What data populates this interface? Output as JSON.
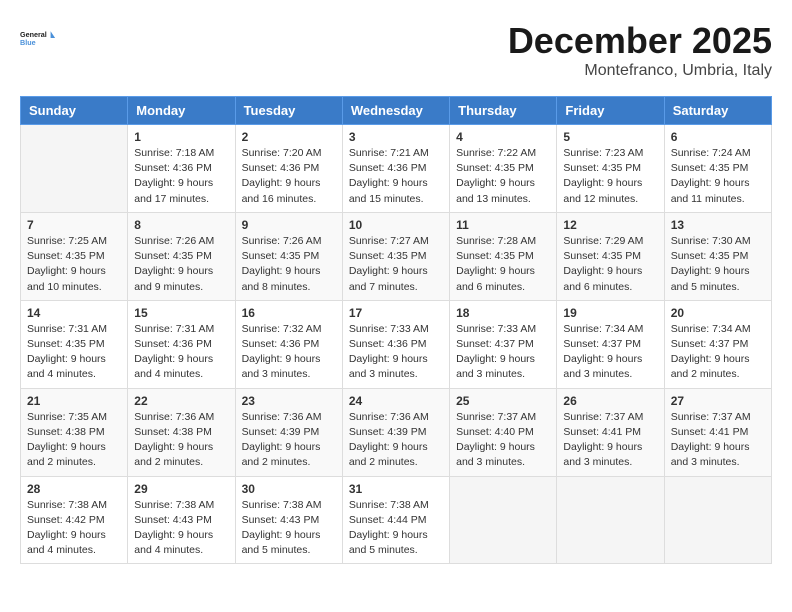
{
  "header": {
    "logo_line1": "General",
    "logo_line2": "Blue",
    "month": "December 2025",
    "location": "Montefranco, Umbria, Italy"
  },
  "days_of_week": [
    "Sunday",
    "Monday",
    "Tuesday",
    "Wednesday",
    "Thursday",
    "Friday",
    "Saturday"
  ],
  "weeks": [
    [
      {
        "day": "",
        "sunrise": "",
        "sunset": "",
        "daylight": ""
      },
      {
        "day": "1",
        "sunrise": "Sunrise: 7:18 AM",
        "sunset": "Sunset: 4:36 PM",
        "daylight": "Daylight: 9 hours and 17 minutes."
      },
      {
        "day": "2",
        "sunrise": "Sunrise: 7:20 AM",
        "sunset": "Sunset: 4:36 PM",
        "daylight": "Daylight: 9 hours and 16 minutes."
      },
      {
        "day": "3",
        "sunrise": "Sunrise: 7:21 AM",
        "sunset": "Sunset: 4:36 PM",
        "daylight": "Daylight: 9 hours and 15 minutes."
      },
      {
        "day": "4",
        "sunrise": "Sunrise: 7:22 AM",
        "sunset": "Sunset: 4:35 PM",
        "daylight": "Daylight: 9 hours and 13 minutes."
      },
      {
        "day": "5",
        "sunrise": "Sunrise: 7:23 AM",
        "sunset": "Sunset: 4:35 PM",
        "daylight": "Daylight: 9 hours and 12 minutes."
      },
      {
        "day": "6",
        "sunrise": "Sunrise: 7:24 AM",
        "sunset": "Sunset: 4:35 PM",
        "daylight": "Daylight: 9 hours and 11 minutes."
      }
    ],
    [
      {
        "day": "7",
        "sunrise": "Sunrise: 7:25 AM",
        "sunset": "Sunset: 4:35 PM",
        "daylight": "Daylight: 9 hours and 10 minutes."
      },
      {
        "day": "8",
        "sunrise": "Sunrise: 7:26 AM",
        "sunset": "Sunset: 4:35 PM",
        "daylight": "Daylight: 9 hours and 9 minutes."
      },
      {
        "day": "9",
        "sunrise": "Sunrise: 7:26 AM",
        "sunset": "Sunset: 4:35 PM",
        "daylight": "Daylight: 9 hours and 8 minutes."
      },
      {
        "day": "10",
        "sunrise": "Sunrise: 7:27 AM",
        "sunset": "Sunset: 4:35 PM",
        "daylight": "Daylight: 9 hours and 7 minutes."
      },
      {
        "day": "11",
        "sunrise": "Sunrise: 7:28 AM",
        "sunset": "Sunset: 4:35 PM",
        "daylight": "Daylight: 9 hours and 6 minutes."
      },
      {
        "day": "12",
        "sunrise": "Sunrise: 7:29 AM",
        "sunset": "Sunset: 4:35 PM",
        "daylight": "Daylight: 9 hours and 6 minutes."
      },
      {
        "day": "13",
        "sunrise": "Sunrise: 7:30 AM",
        "sunset": "Sunset: 4:35 PM",
        "daylight": "Daylight: 9 hours and 5 minutes."
      }
    ],
    [
      {
        "day": "14",
        "sunrise": "Sunrise: 7:31 AM",
        "sunset": "Sunset: 4:35 PM",
        "daylight": "Daylight: 9 hours and 4 minutes."
      },
      {
        "day": "15",
        "sunrise": "Sunrise: 7:31 AM",
        "sunset": "Sunset: 4:36 PM",
        "daylight": "Daylight: 9 hours and 4 minutes."
      },
      {
        "day": "16",
        "sunrise": "Sunrise: 7:32 AM",
        "sunset": "Sunset: 4:36 PM",
        "daylight": "Daylight: 9 hours and 3 minutes."
      },
      {
        "day": "17",
        "sunrise": "Sunrise: 7:33 AM",
        "sunset": "Sunset: 4:36 PM",
        "daylight": "Daylight: 9 hours and 3 minutes."
      },
      {
        "day": "18",
        "sunrise": "Sunrise: 7:33 AM",
        "sunset": "Sunset: 4:37 PM",
        "daylight": "Daylight: 9 hours and 3 minutes."
      },
      {
        "day": "19",
        "sunrise": "Sunrise: 7:34 AM",
        "sunset": "Sunset: 4:37 PM",
        "daylight": "Daylight: 9 hours and 3 minutes."
      },
      {
        "day": "20",
        "sunrise": "Sunrise: 7:34 AM",
        "sunset": "Sunset: 4:37 PM",
        "daylight": "Daylight: 9 hours and 2 minutes."
      }
    ],
    [
      {
        "day": "21",
        "sunrise": "Sunrise: 7:35 AM",
        "sunset": "Sunset: 4:38 PM",
        "daylight": "Daylight: 9 hours and 2 minutes."
      },
      {
        "day": "22",
        "sunrise": "Sunrise: 7:36 AM",
        "sunset": "Sunset: 4:38 PM",
        "daylight": "Daylight: 9 hours and 2 minutes."
      },
      {
        "day": "23",
        "sunrise": "Sunrise: 7:36 AM",
        "sunset": "Sunset: 4:39 PM",
        "daylight": "Daylight: 9 hours and 2 minutes."
      },
      {
        "day": "24",
        "sunrise": "Sunrise: 7:36 AM",
        "sunset": "Sunset: 4:39 PM",
        "daylight": "Daylight: 9 hours and 2 minutes."
      },
      {
        "day": "25",
        "sunrise": "Sunrise: 7:37 AM",
        "sunset": "Sunset: 4:40 PM",
        "daylight": "Daylight: 9 hours and 3 minutes."
      },
      {
        "day": "26",
        "sunrise": "Sunrise: 7:37 AM",
        "sunset": "Sunset: 4:41 PM",
        "daylight": "Daylight: 9 hours and 3 minutes."
      },
      {
        "day": "27",
        "sunrise": "Sunrise: 7:37 AM",
        "sunset": "Sunset: 4:41 PM",
        "daylight": "Daylight: 9 hours and 3 minutes."
      }
    ],
    [
      {
        "day": "28",
        "sunrise": "Sunrise: 7:38 AM",
        "sunset": "Sunset: 4:42 PM",
        "daylight": "Daylight: 9 hours and 4 minutes."
      },
      {
        "day": "29",
        "sunrise": "Sunrise: 7:38 AM",
        "sunset": "Sunset: 4:43 PM",
        "daylight": "Daylight: 9 hours and 4 minutes."
      },
      {
        "day": "30",
        "sunrise": "Sunrise: 7:38 AM",
        "sunset": "Sunset: 4:43 PM",
        "daylight": "Daylight: 9 hours and 5 minutes."
      },
      {
        "day": "31",
        "sunrise": "Sunrise: 7:38 AM",
        "sunset": "Sunset: 4:44 PM",
        "daylight": "Daylight: 9 hours and 5 minutes."
      },
      {
        "day": "",
        "sunrise": "",
        "sunset": "",
        "daylight": ""
      },
      {
        "day": "",
        "sunrise": "",
        "sunset": "",
        "daylight": ""
      },
      {
        "day": "",
        "sunrise": "",
        "sunset": "",
        "daylight": ""
      }
    ]
  ]
}
